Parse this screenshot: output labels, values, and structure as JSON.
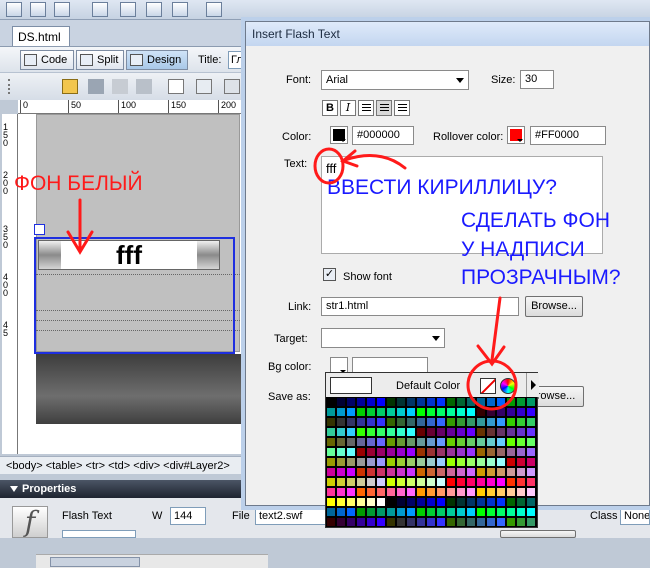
{
  "document": {
    "tab_name": "DS.html",
    "view_buttons": [
      "Code",
      "Split",
      "Design"
    ],
    "title_label": "Title:",
    "title_value": "Гл",
    "ruler_labels": [
      "0",
      "50",
      "100",
      "150",
      "200"
    ],
    "ruler_left_labels": [
      "1",
      "5",
      "0",
      "2",
      "0",
      "0",
      "3",
      "5",
      "0",
      "4",
      "0",
      "0",
      "4",
      "5"
    ],
    "flash_text": "fff",
    "tag_selector": "<body> <table> <tr> <td> <div> <div#Layer2>"
  },
  "properties": {
    "header": "Properties",
    "type_label": "Flash Text",
    "w_label": "W",
    "w_value": "144",
    "file_label": "File",
    "file_value": "text2.swf",
    "class_label": "Class",
    "class_value": "None"
  },
  "dialog": {
    "title": "Insert Flash Text",
    "font_label": "Font:",
    "font_value": "Arial",
    "size_label": "Size:",
    "size_value": "30",
    "format_buttons": [
      "B",
      "I"
    ],
    "color_label": "Color:",
    "color_value": "#000000",
    "color_hex": "#000000",
    "rollover_label": "Rollover color:",
    "rollover_value": "#FF0000",
    "rollover_hex": "#FF0000",
    "text_label": "Text:",
    "text_value": "fff",
    "show_font_label": "Show font",
    "link_label": "Link:",
    "link_value": "str1.html",
    "browse_label": "Browse...",
    "target_label": "Target:",
    "target_value": "",
    "bgcolor_label": "Bg color:",
    "bgcolor_value": "",
    "save_as_label": "Save as:",
    "browse2_label": "rowse..."
  },
  "picker": {
    "default_label": "Default Color"
  },
  "annotations": {
    "bg_white": "ФОН БЕЛЫЙ",
    "cyrillic_question": "ВВЕСТИ КИРИЛЛИЦУ?",
    "transparent_line1": "СДЕЛАТЬ ФОН",
    "transparent_line2": "У НАДПИСИ",
    "transparent_line3": "ПРОЗРАЧНЫМ?",
    "red_color": "#ff1a1a",
    "blue_color": "#1a1aff"
  }
}
